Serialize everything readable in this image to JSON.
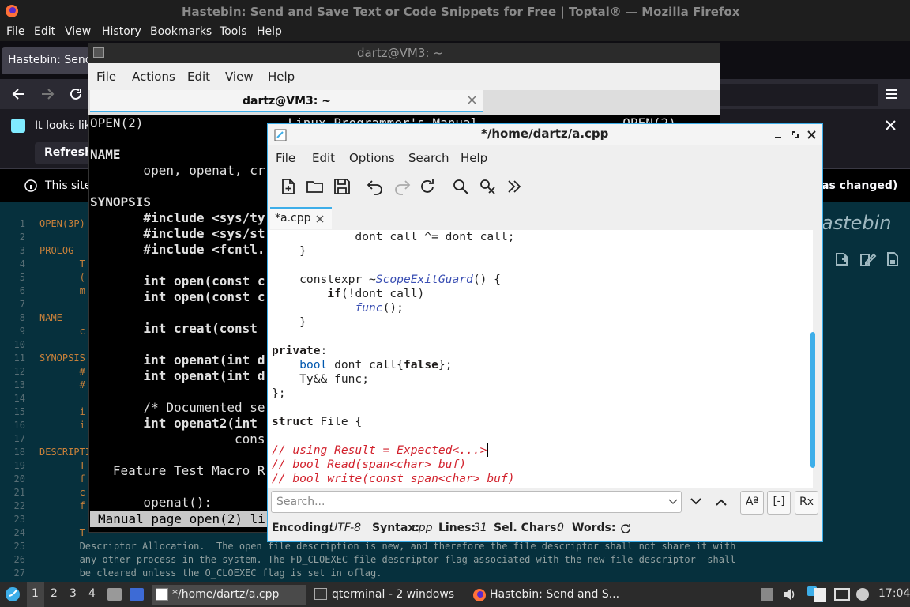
{
  "firefox": {
    "window_title": "Hastebin: Send and Save Text or Code Snippets for Free | Toptal® — Mozilla Firefox",
    "menu": [
      "File",
      "Edit",
      "View",
      "History",
      "Bookmarks",
      "Tools",
      "Help"
    ],
    "tab_label": "Hastebin: Send",
    "info_text": "It looks lik",
    "refresh_label": "Refresh",
    "notice_left": "This site",
    "notice_right": "as changed)",
    "hastebin_logo": "astebin"
  },
  "hastebin": {
    "line_numbers": [
      "1",
      "2",
      "3",
      "4",
      "5",
      "6",
      "7",
      "8",
      "9",
      "10",
      "11",
      "12",
      "13",
      "14",
      "15",
      "16",
      "17",
      "18",
      "19",
      "20",
      "21",
      "22",
      "23",
      "24",
      "25",
      "26",
      "27"
    ],
    "lines": [
      "OPEN(3P)",
      "",
      "PROLOG",
      "       T",
      "       (",
      "       m",
      "",
      "NAME",
      "       c",
      "",
      "SYNOPSIS",
      "       #",
      "       #",
      "",
      "       i",
      "       i",
      "",
      "DESCRIPTION",
      "       T",
      "       f",
      "       c",
      "       f",
      "",
      "       T",
      "       Descriptor Allocation.  The open file description is new, and therefore the file descriptor shall not share it with",
      "       any other process in the system. The FD_CLOEXEC file descriptor flag associated with the new file descriptor  shall",
      "       be cleared unless the O_CLOEXEC flag is set in oflag."
    ]
  },
  "terminal": {
    "window_title": "dartz@VM3: ~",
    "menu": [
      "File",
      "Actions",
      "Edit",
      "View",
      "Help"
    ],
    "tab_label": "dartz@VM3: ~",
    "lines": [
      "OPEN(2)                   Linux Programmer's Manual                   OPEN(2)",
      "",
      "NAME",
      "       open, openat, cr",
      "",
      "SYNOPSIS",
      "       #include <sys/ty",
      "       #include <sys/st",
      "       #include <fcntl.",
      "",
      "       int open(const c",
      "       int open(const c",
      "",
      "       int creat(const",
      "",
      "       int openat(int d",
      "       int openat(int d",
      "",
      "       /* Documented se",
      "       int openat2(int",
      "                   cons",
      "",
      "   Feature Test Macro R",
      "",
      "       openat():"
    ],
    "status": "Manual page open(2) li"
  },
  "editor": {
    "window_title": "*/home/dartz/a.cpp",
    "menu": [
      "File",
      "Edit",
      "Options",
      "Search",
      "Help"
    ],
    "tab_label": "*a.cpp",
    "search_placeholder": "Search...",
    "status": {
      "encoding_label": "Encoding:",
      "encoding": "UTF-8",
      "syntax_label": "Syntax:",
      "syntax": "cpp",
      "lines_label": "Lines:",
      "lines": "31",
      "sel_label": "Sel. Chars:",
      "sel": "0",
      "words_label": "Words:"
    },
    "code": [
      [
        {
          "t": "            dont_call ^= dont_call;",
          "c": "n"
        }
      ],
      [
        {
          "t": "    }",
          "c": "n"
        }
      ],
      [
        {
          "t": "",
          "c": "n"
        }
      ],
      [
        {
          "t": "    constexpr ~",
          "c": "n"
        },
        {
          "t": "ScopeExitGuard",
          "c": "f"
        },
        {
          "t": "() {",
          "c": "n"
        }
      ],
      [
        {
          "t": "        ",
          "c": "n"
        },
        {
          "t": "if",
          "c": "k"
        },
        {
          "t": "(!dont_call)",
          "c": "n"
        }
      ],
      [
        {
          "t": "            ",
          "c": "n"
        },
        {
          "t": "func",
          "c": "f"
        },
        {
          "t": "();",
          "c": "n"
        }
      ],
      [
        {
          "t": "    }",
          "c": "n"
        }
      ],
      [
        {
          "t": "",
          "c": "n"
        }
      ],
      [
        {
          "t": "private",
          "c": "k"
        },
        {
          "t": ":",
          "c": "n"
        }
      ],
      [
        {
          "t": "    ",
          "c": "n"
        },
        {
          "t": "bool",
          "c": "ty"
        },
        {
          "t": " dont_call{",
          "c": "n"
        },
        {
          "t": "false",
          "c": "k"
        },
        {
          "t": "};",
          "c": "n"
        }
      ],
      [
        {
          "t": "    Ty&& func;",
          "c": "n"
        }
      ],
      [
        {
          "t": "};",
          "c": "n"
        }
      ],
      [
        {
          "t": "",
          "c": "n"
        }
      ],
      [
        {
          "t": "struct",
          "c": "k"
        },
        {
          "t": " File {",
          "c": "n"
        }
      ],
      [
        {
          "t": "",
          "c": "n"
        }
      ],
      [
        {
          "t": "// using Result = Expected<...>",
          "c": "cm"
        }
      ],
      [
        {
          "t": "// bool Read(span<char> buf)",
          "c": "cm"
        }
      ],
      [
        {
          "t": "// bool write(const span<char> buf)",
          "c": "cm"
        }
      ]
    ]
  },
  "taskbar": {
    "workspaces": [
      "1",
      "2",
      "3",
      "4"
    ],
    "tasks": [
      "*/home/dartz/a.cpp",
      "qterminal - 2 windows",
      "Hastebin: Send and S..."
    ],
    "clock": "17:04"
  },
  "colors": {
    "accent": "#3daee9",
    "comment": "#d2222d",
    "function": "#3a4fb3",
    "keyword": "#1f1c1b"
  }
}
